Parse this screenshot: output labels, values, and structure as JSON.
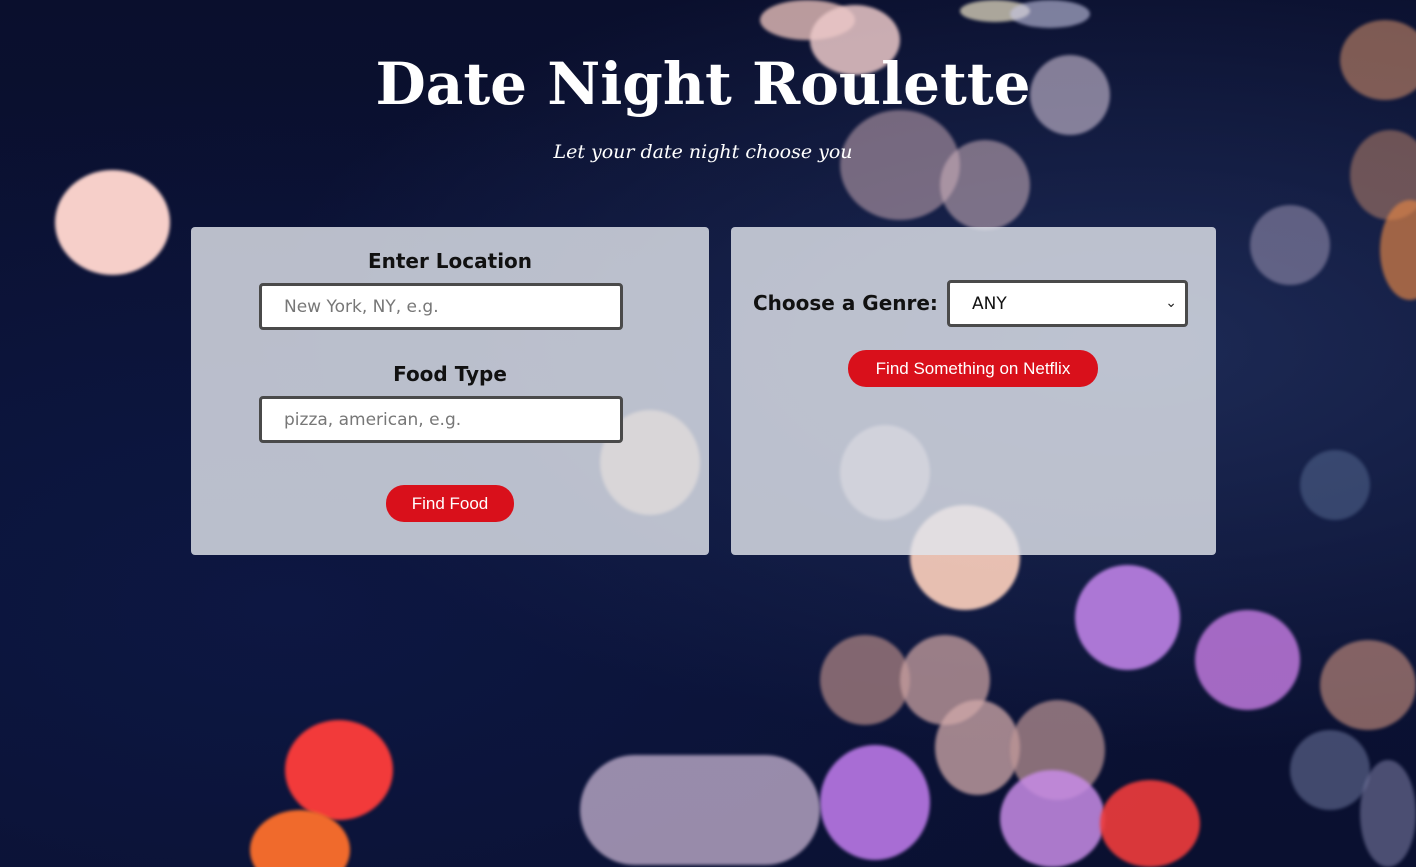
{
  "header": {
    "title": "Date Night Roulette",
    "subtitle": "Let your date night choose you"
  },
  "food_panel": {
    "location_label": "Enter Location",
    "location_placeholder": "New York, NY, e.g.",
    "location_value": "",
    "food_type_label": "Food Type",
    "food_type_placeholder": "pizza, american, e.g.",
    "food_type_value": "",
    "submit_label": "Find Food"
  },
  "movie_panel": {
    "genre_label": "Choose a Genre:",
    "genre_selected": "ANY",
    "submit_label": "Find Something on Netflix"
  },
  "icons": {
    "genre_dropdown": "chevron-down-icon"
  },
  "colors": {
    "accent_red": "#d9101b",
    "background_dark": "#0b1030",
    "panel_bg": "#e1e4eb"
  }
}
